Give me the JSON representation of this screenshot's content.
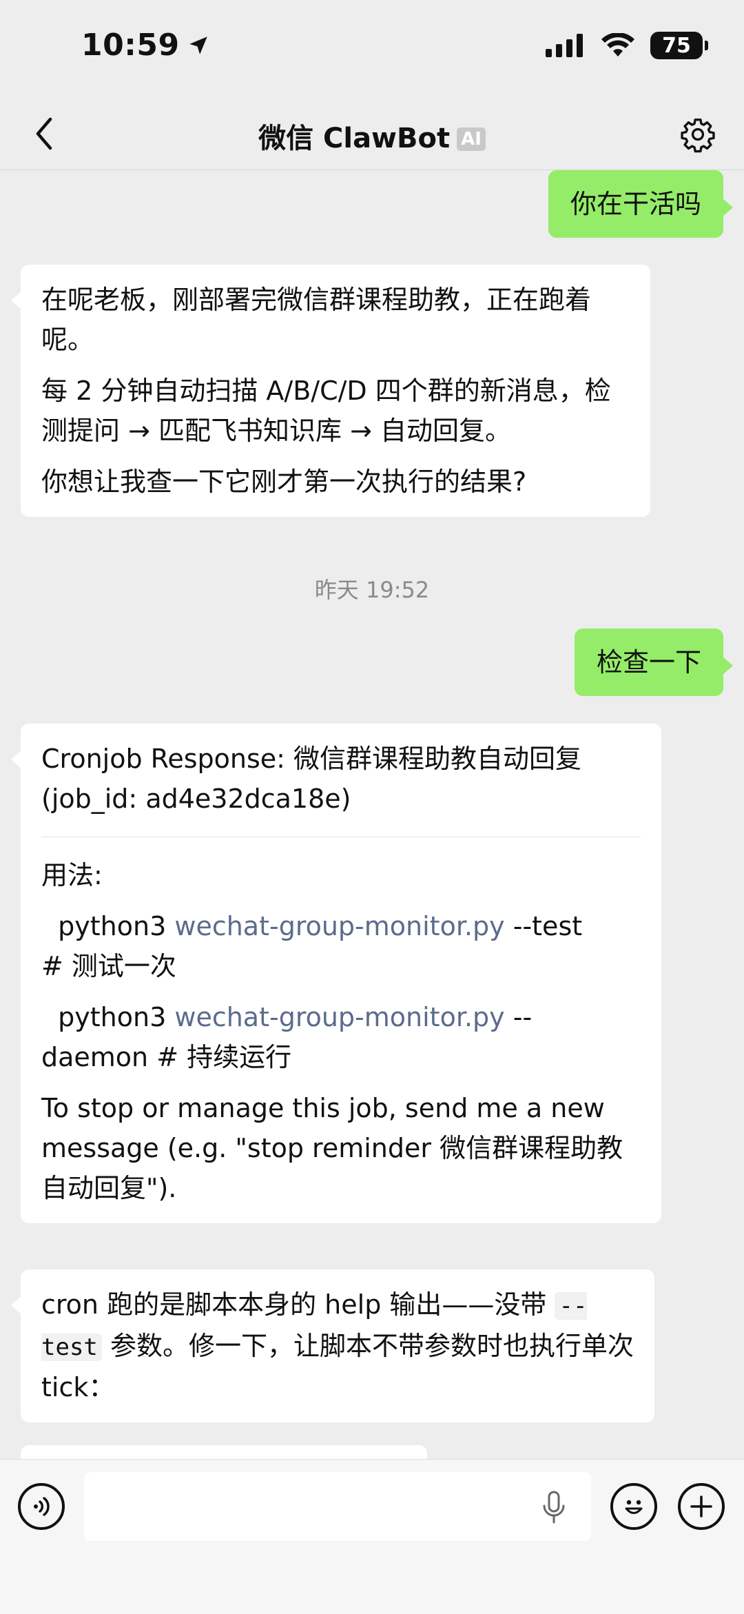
{
  "status": {
    "time": "10:59",
    "battery": "75"
  },
  "nav": {
    "title": "微信 ClawBot",
    "badge": "AI"
  },
  "messages": [
    {
      "side": "out",
      "text": "你在干活吗"
    },
    {
      "side": "in",
      "paragraphs": [
        "在呢老板，刚部署完微信群课程助教，正在跑着呢。",
        "每 2 分钟自动扫描 A/B/C/D 四个群的新消息，检测提问 → 匹配飞书知识库 → 自动回复。",
        "你想让我查一下它刚才第一次执行的结果?"
      ]
    },
    {
      "side": "out",
      "text": "检查一下"
    },
    {
      "side": "in",
      "title": "Cronjob Response: 微信群课程助教自动回复 (job_id: ad4e32dca18e)",
      "usage_label": "用法:",
      "line1_prefix": "python3 ",
      "line1_link": "wechat-group-monitor.py",
      "line1_suffix": " --test",
      "line1_comment": "# 测试一次",
      "line2_prefix": "python3 ",
      "line2_link": "wechat-group-monitor.py",
      "line2_suffix": " --",
      "line2_cont": "daemon  # 持续运行",
      "footer": "To stop or manage this job, send me a new message (e.g. \"stop reminder 微信群课程助教自动回复\")."
    },
    {
      "side": "in",
      "text_before": "cron 跑的是脚本本身的 help 输出——没带 ",
      "code": "--test",
      "text_after": " 参数。修一下，让脚本不带参数时也执行单次 tick："
    }
  ],
  "timestamp": "昨天 19:52",
  "input": {
    "value": "",
    "placeholder": ""
  },
  "icons": {
    "back": "chevron-left-icon",
    "settings": "gear-icon",
    "location": "location-arrow-icon",
    "signal": "signal-icon",
    "wifi": "wifi-icon",
    "voice": "voice-icon",
    "mic": "microphone-icon",
    "emoji": "emoji-icon",
    "add": "plus-icon"
  },
  "colors": {
    "background": "#ededed",
    "outgoing": "#95ec69",
    "incoming": "#ffffff",
    "link": "#5b6b8c"
  }
}
